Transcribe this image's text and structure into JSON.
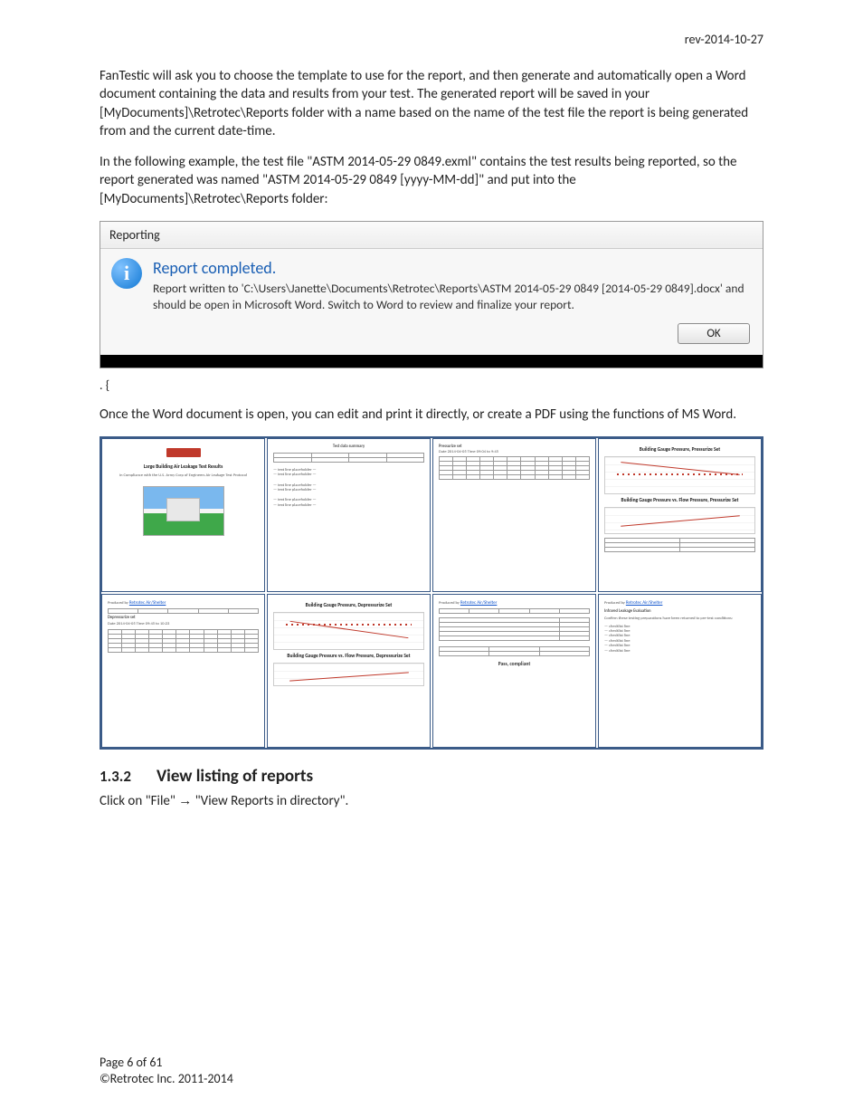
{
  "header": {
    "revision": "rev-2014-10-27"
  },
  "paragraphs": {
    "p1": "FanTestic will ask you to choose the template to use for the report, and then generate and automatically open a Word document containing the data and results from your test.  The generated report will be saved in your [MyDocuments]\\Retrotec\\Reports  folder  with a name based on the name of the test file the report is being generated from and the current date-time.",
    "p2": "In the following example, the test file \"ASTM 2014-05-29 0849.exml\" contains the test results being reported, so the report generated was named \"ASTM 2014-05-29 0849 [yyyy-MM-dd]\"  and put into the [MyDocuments]\\Retrotec\\Reports folder:",
    "p3_prefix": ".  {",
    "p4": "Once the Word document is open, you can edit and print it directly, or create a PDF using the functions of MS Word."
  },
  "dialog": {
    "title": "Reporting",
    "heading": "Report completed.",
    "body": "Report written to 'C:\\Users\\Janette\\Documents\\Retrotec\\Reports\\ASTM 2014-05-29 0849 [2014-05-29 0849].docx' and should be open in Microsoft Word. Switch to Word to review and finalize your report.",
    "ok": "OK"
  },
  "thumbs": {
    "t1": {
      "title": "Large Building Air Leakage Test Results",
      "subtitle": "In Compliance with the U.S. Army Corp of Engineers Air Leakage Test Protocol"
    },
    "t2": {
      "heading": "Test data summary"
    },
    "t3": {
      "heading": "Pressurize set"
    },
    "t4": {
      "heading1": "Building Gauge Pressure, Pressurize Set",
      "heading2": "Building Gauge Pressure vs. Flow Pressure, Pressurize Set"
    },
    "t5": {
      "heading": "Depressurize set",
      "link": "Retrotec Air/Shelter"
    },
    "t6": {
      "heading1": "Building Gauge Pressure, Depressurize Set",
      "heading2": "Building Gauge Pressure vs. Flow Pressure, Depressurize Set"
    },
    "t7": {
      "link": "Retrotec Air/Shelter",
      "result": "Pass, compliant"
    },
    "t8": {
      "link": "Retrotec Air/Shelter",
      "heading": "Infrared Leakage Evaluation",
      "sub": "Confirm these testing preparations have been returned to pre-test conditions:"
    }
  },
  "section": {
    "number": "1.3.2",
    "title": "View listing of reports",
    "instruction_pre": "Click on \"File\" ",
    "instruction_post": " \"View Reports in directory\"."
  },
  "footer": {
    "page": "Page 6 of 61",
    "copyright": "©Retrotec Inc. 2011-2014"
  }
}
